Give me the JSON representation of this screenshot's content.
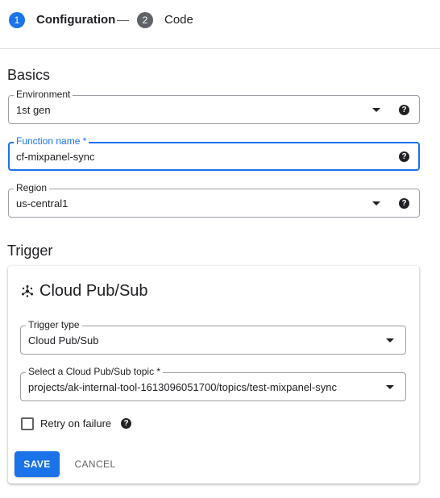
{
  "stepper": {
    "steps": [
      {
        "number": "1",
        "label": "Configuration"
      },
      {
        "number": "2",
        "label": "Code"
      }
    ]
  },
  "basics": {
    "title": "Basics",
    "environment": {
      "label": "Environment",
      "value": "1st gen",
      "help_icon": "help-circle-icon"
    },
    "function_name": {
      "label": "Function name *",
      "value": "cf-mixpanel-sync",
      "help_icon": "help-circle-icon"
    },
    "region": {
      "label": "Region",
      "value": "us-central1",
      "help_icon": "help-circle-icon"
    }
  },
  "trigger": {
    "title": "Trigger",
    "card": {
      "icon": "pubsub-icon",
      "title": "Cloud Pub/Sub",
      "trigger_type": {
        "label": "Trigger type",
        "value": "Cloud Pub/Sub"
      },
      "topic": {
        "label": "Select a Cloud Pub/Sub topic *",
        "value": "projects/ak-internal-tool-1613096051700/topics/test-mixpanel-sync"
      },
      "retry": {
        "label": "Retry on failure",
        "checked": false,
        "help_icon": "help-circle-icon"
      },
      "save_label": "SAVE",
      "cancel_label": "CANCEL"
    }
  },
  "colors": {
    "accent": "#1a73e8",
    "text": "#202124",
    "muted": "#5f6368",
    "border": "#9aa0a6"
  }
}
